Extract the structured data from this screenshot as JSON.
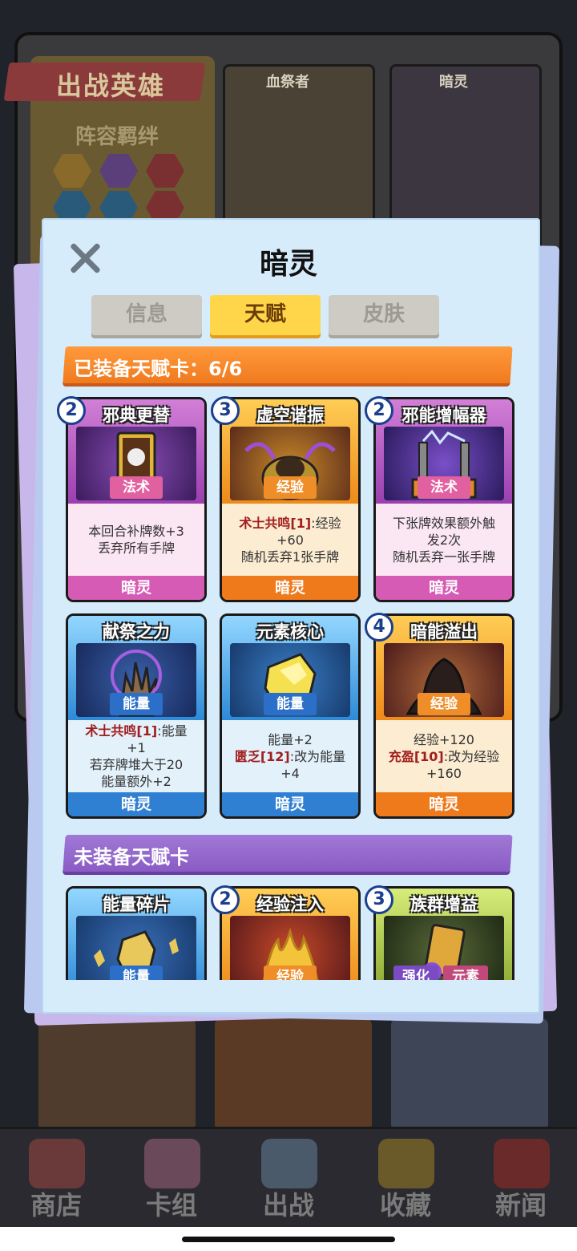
{
  "background": {
    "banner_title": "出战英雄",
    "bond_label": "阵容羁绊",
    "heroes": [
      "血祭者",
      "暗灵"
    ]
  },
  "nav": [
    {
      "label": "商店",
      "icon": "shop-icon"
    },
    {
      "label": "卡组",
      "icon": "deck-icon"
    },
    {
      "label": "出战",
      "icon": "battle-icon"
    },
    {
      "label": "收藏",
      "icon": "collection-icon"
    },
    {
      "label": "新闻",
      "icon": "news-icon"
    }
  ],
  "dialog": {
    "title": "暗灵",
    "close_icon": "close-icon",
    "tabs": [
      {
        "label": "信息",
        "active": false
      },
      {
        "label": "天赋",
        "active": true
      },
      {
        "label": "皮肤",
        "active": false
      }
    ],
    "equipped_header": "已装备天赋卡：6/6",
    "unequipped_header": "未装备天赋卡",
    "equipped_cards": [
      {
        "name": "邪典更替",
        "cost": "2",
        "type": "法术",
        "theme": "pink",
        "desc": [
          "本回合补牌数+3",
          "丢弃所有手牌"
        ],
        "hero": "暗灵"
      },
      {
        "name": "虚空谐振",
        "cost": "3",
        "type": "经验",
        "theme": "orange",
        "desc_hl": "术士共鸣[1]",
        "desc_rest": ":经验",
        "desc": [
          "+60",
          "随机丢弃1张手牌"
        ],
        "hero": "暗灵"
      },
      {
        "name": "邪能增幅器",
        "cost": "2",
        "type": "法术",
        "theme": "pink",
        "desc": [
          "下张牌效果额外触",
          "发2次",
          "随机丢弃一张手牌"
        ],
        "hero": "暗灵"
      },
      {
        "name": "献祭之力",
        "cost": "",
        "type": "能量",
        "theme": "blue",
        "desc_hl": "术士共鸣[1]",
        "desc_rest": ":能量",
        "desc": [
          "+1",
          "若弃牌堆大于20",
          "能量额外+2"
        ],
        "hero": "暗灵"
      },
      {
        "name": "元素核心",
        "cost": "",
        "type": "能量",
        "theme": "blue",
        "desc_top": "能量+2",
        "desc_hl": "匮乏[12]",
        "desc_rest": ":改为能量",
        "desc": [
          "+4"
        ],
        "hero": "暗灵"
      },
      {
        "name": "暗能溢出",
        "cost": "4",
        "type": "经验",
        "theme": "orange",
        "desc_top": "经验+120",
        "desc_hl": "充盈[10]",
        "desc_rest": ":改为经验",
        "desc": [
          "+160"
        ],
        "hero": "暗灵"
      }
    ],
    "unequipped_cards": [
      {
        "name": "能量碎片",
        "cost": "",
        "type": "能量",
        "theme": "blue"
      },
      {
        "name": "经验注入",
        "cost": "2",
        "type": "经验",
        "theme": "orange"
      },
      {
        "name": "族群增益",
        "cost": "3",
        "types": [
          "强化",
          "元素"
        ],
        "theme": "green"
      }
    ]
  }
}
